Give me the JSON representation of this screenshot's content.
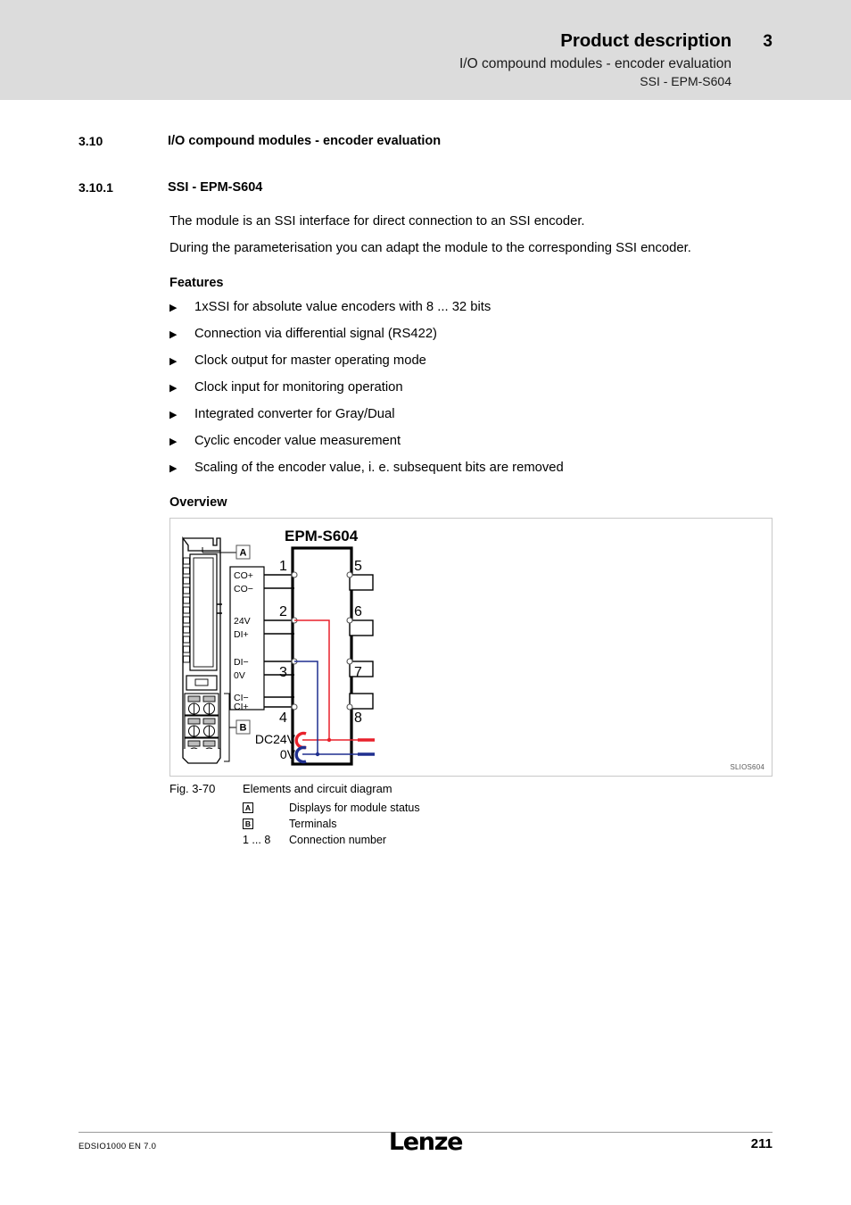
{
  "header": {
    "title": "Product description",
    "chapter": "3",
    "subtitle1": "I/O compound modules - encoder evaluation",
    "subtitle2": "SSI - EPM-S604"
  },
  "sections": [
    {
      "number": "3.10",
      "title": "I/O compound modules - encoder evaluation"
    },
    {
      "number": "3.10.1",
      "title": "SSI - EPM-S604"
    }
  ],
  "intro": {
    "line1": "The module is an SSI interface for direct connection to an SSI encoder.",
    "line2": "During the parameterisation you can adapt the module to the corresponding SSI encoder."
  },
  "features": {
    "heading": "Features",
    "bullet_glyph": "▶",
    "items": [
      "1xSSI for absolute value encoders with 8 ... 32 bits",
      "Connection via differential signal (RS422)",
      "Clock output for master operating mode",
      "Clock input for monitoring operation",
      "Integrated converter for Gray/Dual",
      "Cyclic encoder value measurement",
      "Scaling of the encoder value, i. e. subsequent bits are removed"
    ]
  },
  "overview": {
    "heading": "Overview"
  },
  "figure": {
    "module_title": "EPM-S604",
    "watermark": "SLIOS604",
    "callout_a": "A",
    "callout_b": "B",
    "terminal_labels": [
      "CO+",
      "CO−",
      "24V",
      "DI+",
      "DI−",
      "0V",
      "CI−",
      "CI+"
    ],
    "pin_numbers_left": [
      "1",
      "2",
      "3",
      "4"
    ],
    "pin_numbers_right": [
      "5",
      "6",
      "7",
      "8"
    ],
    "supply_labels": [
      "DC24V",
      "0V"
    ],
    "colors": {
      "wire_positive": "#e8212b",
      "wire_negative": "#1f2f8f",
      "outline": "#000000",
      "frame_border": "#c8c8c8"
    }
  },
  "caption": {
    "figure_number": "Fig. 3-70",
    "figure_title": "Elements and circuit diagram",
    "legend": [
      {
        "key": "A",
        "text": "Displays for module status"
      },
      {
        "key": "B",
        "text": "Terminals"
      },
      {
        "key": "1 ... 8",
        "text": "Connection number"
      }
    ]
  },
  "footer": {
    "document_id": "EDSIO1000  EN  7.0",
    "brand": "Lenze",
    "page_number": "211"
  }
}
